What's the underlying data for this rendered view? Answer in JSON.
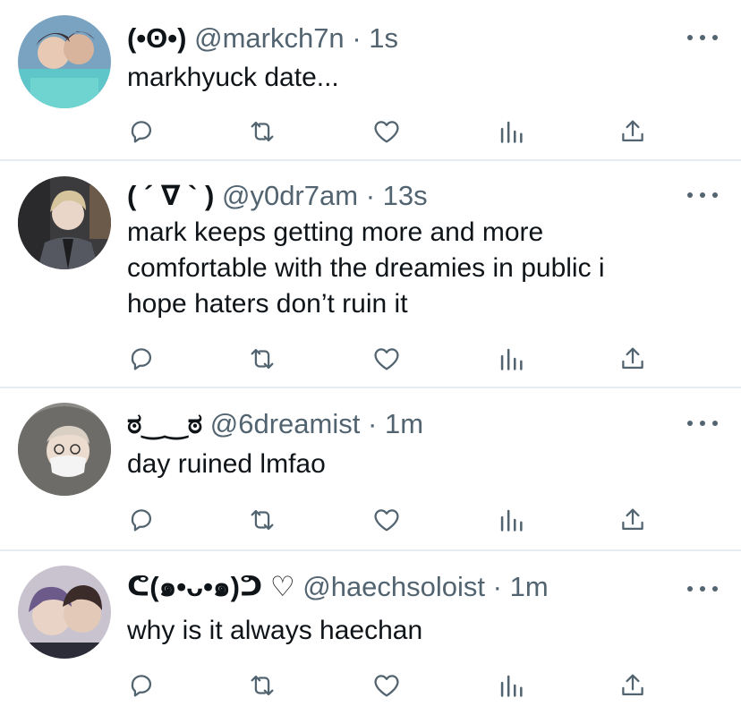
{
  "colors": {
    "text": "#0f1419",
    "secondary": "#536471",
    "divider": "#e6ecf0",
    "icon": "#536471"
  },
  "tweets": [
    {
      "name": "(•ʘ•)",
      "handle": "@markch7n",
      "separator": "·",
      "time": "1s",
      "text": [
        "markhyuck date..."
      ],
      "avatar_icon": "user-avatar-photo"
    },
    {
      "name": "( ´ ∇ ` )",
      "handle": "@y0dr7am",
      "separator": "·",
      "time": "13s",
      "text": [
        "mark keeps getting more and more",
        "comfortable with the dreamies in public i",
        "hope haters don’t ruin it"
      ],
      "avatar_icon": "user-avatar-photo"
    },
    {
      "name": "ಠ‿‿ಠ",
      "handle": "@6dreamist",
      "separator": "·",
      "time": "1m",
      "text": [
        "day ruined lmfao"
      ],
      "avatar_icon": "user-avatar-photo"
    },
    {
      "name": "ᕦ(๑•ᴗ•๑)ᕤ ♡",
      "handle": "@haechsoloist",
      "separator": "·",
      "time": "1m",
      "text": [
        "why is it always haechan"
      ],
      "avatar_icon": "user-avatar-photo"
    }
  ],
  "action_icons": [
    "reply-icon",
    "retweet-icon",
    "like-icon",
    "analytics-icon",
    "share-icon"
  ]
}
